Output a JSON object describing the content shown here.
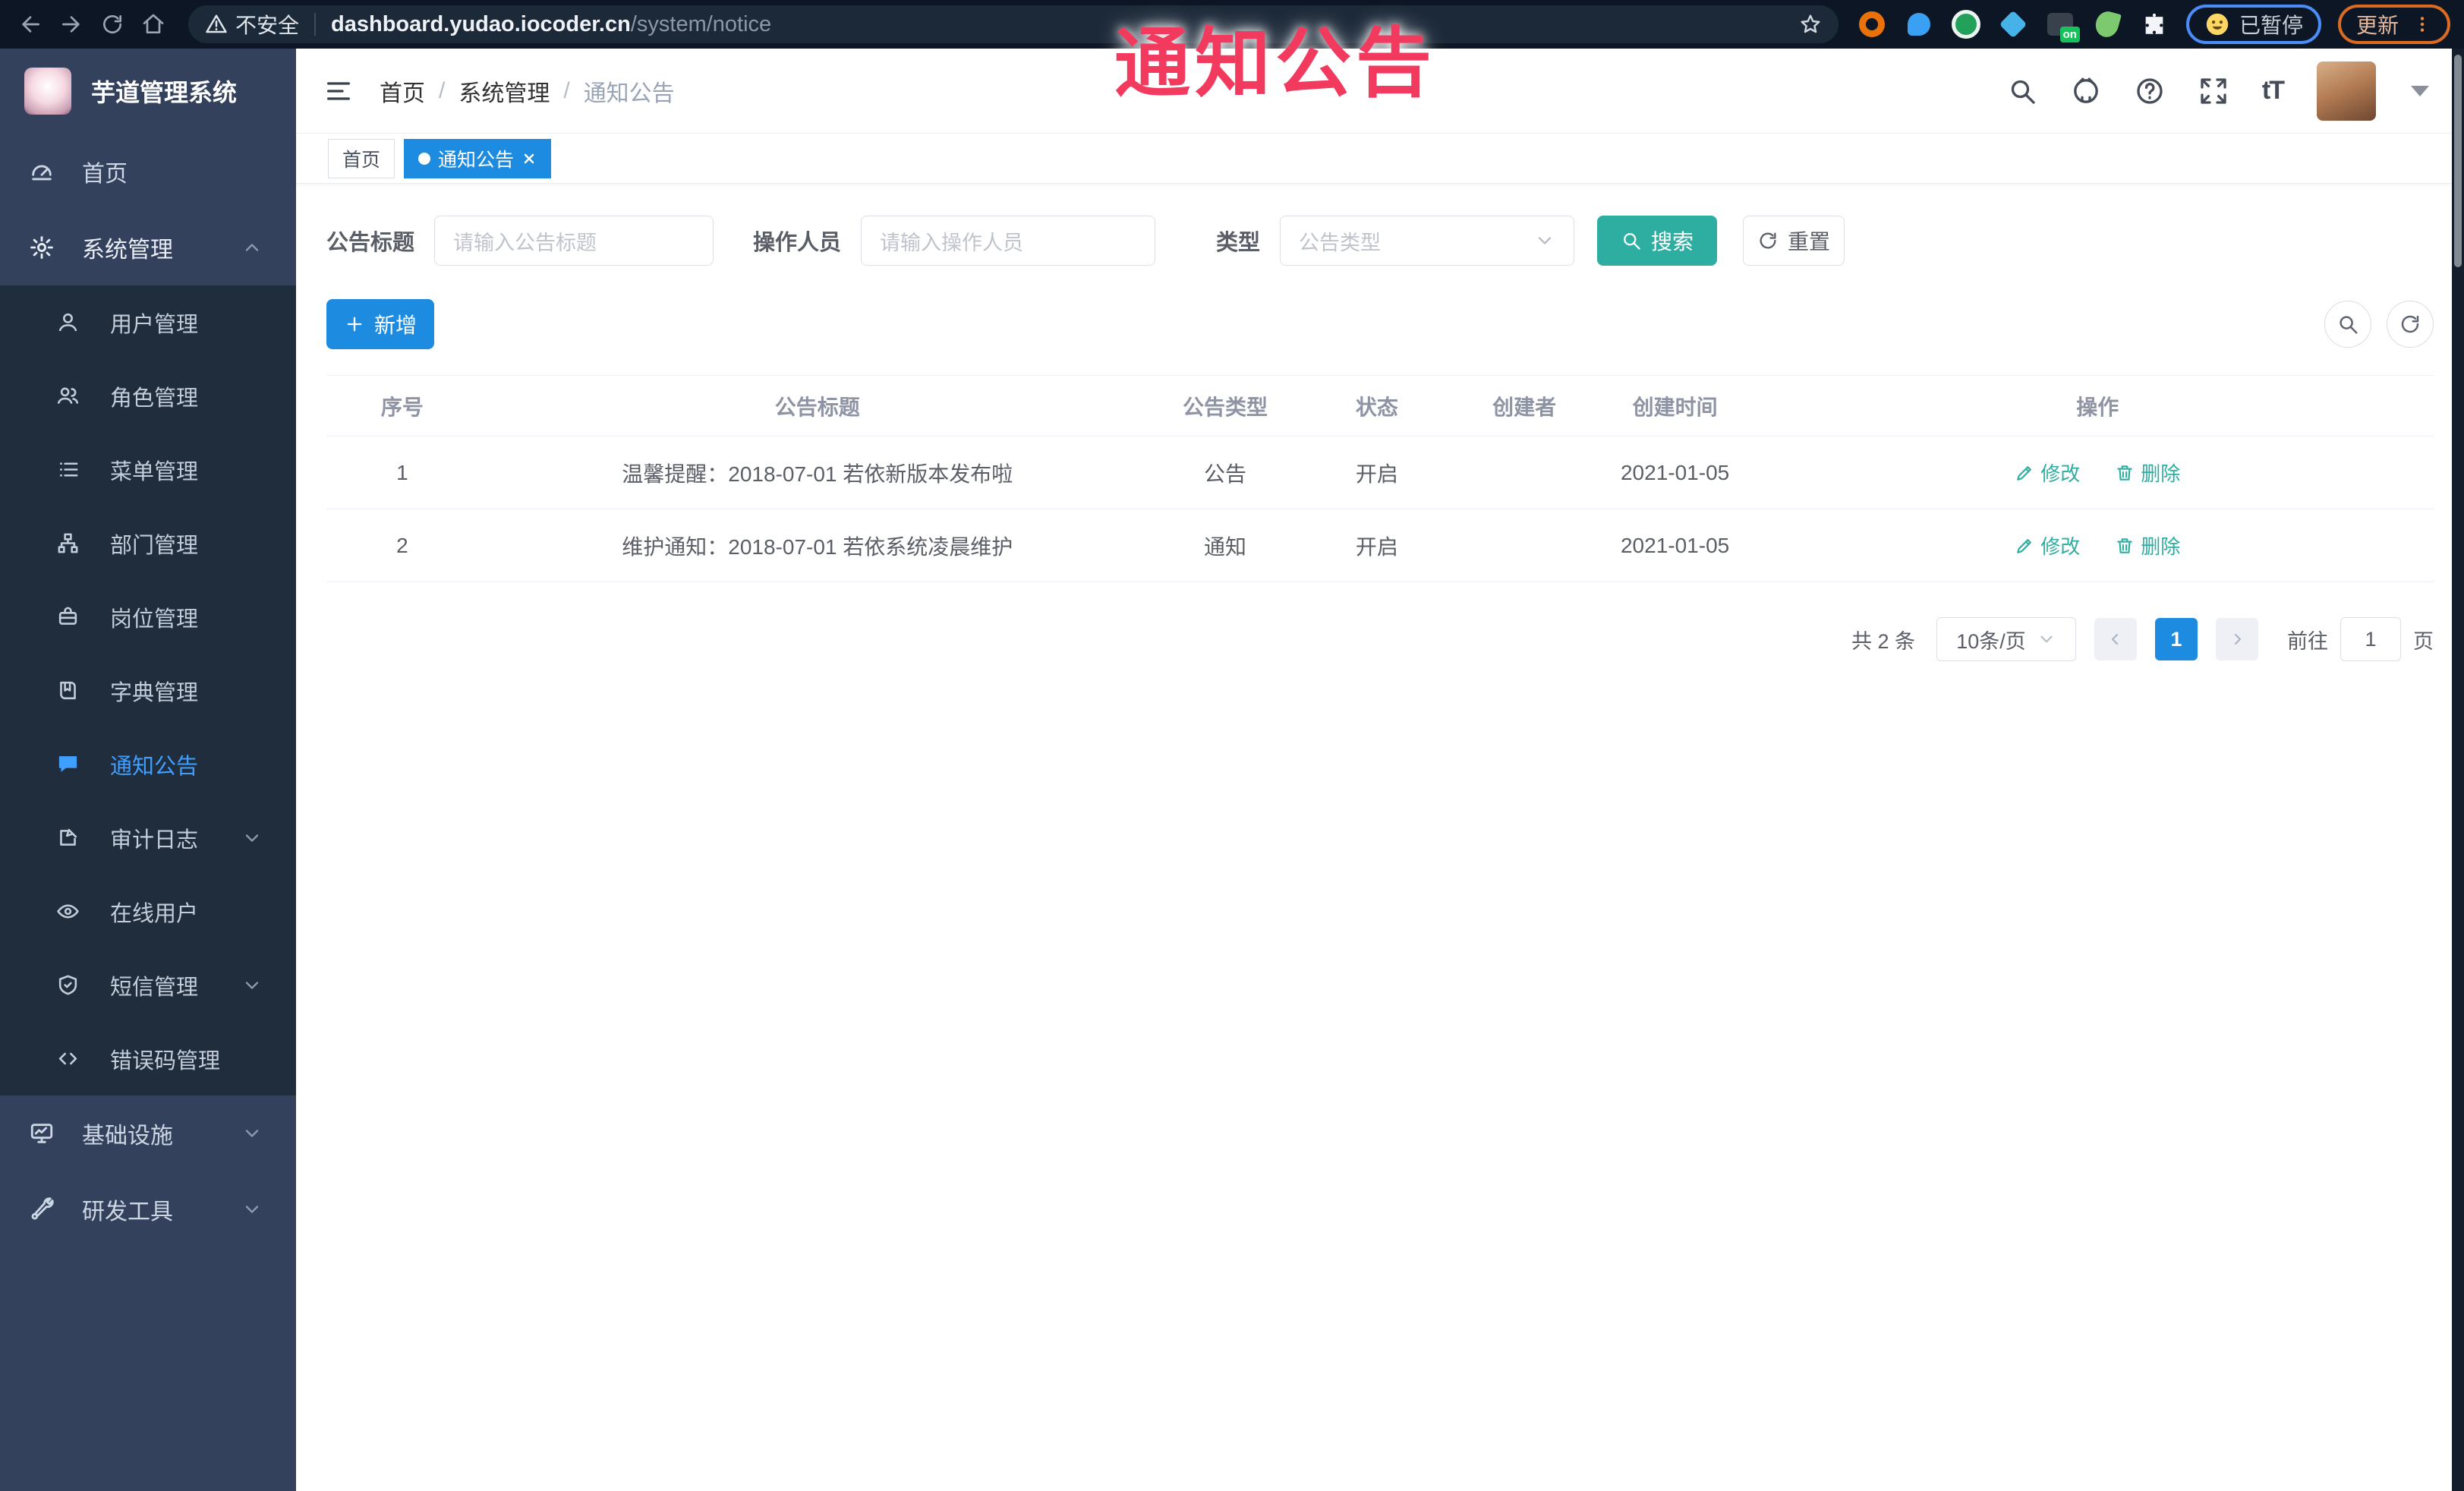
{
  "annotation": {
    "text": "通知公告"
  },
  "colors": {
    "primary": "#1d8ce0",
    "teal": "#2daea0",
    "sidebar": "#33415c",
    "submenu": "#1f2d3d",
    "annotation": "#f23a5f"
  },
  "browser": {
    "security_label": "不安全",
    "url_host": "dashboard.yudao.iocoder.cn",
    "url_path": "/system/notice",
    "paused_badge": "已暂停",
    "update_button": "更新"
  },
  "sidebar": {
    "title": "芋道管理系统",
    "home": "首页",
    "system": "系统管理",
    "children": [
      "用户管理",
      "角色管理",
      "菜单管理",
      "部门管理",
      "岗位管理",
      "字典管理",
      "通知公告",
      "审计日志",
      "在线用户",
      "短信管理",
      "错误码管理"
    ],
    "infra": "基础设施",
    "devtool": "研发工具"
  },
  "header": {
    "breadcrumb": [
      "首页",
      "系统管理",
      "通知公告"
    ]
  },
  "tabs": {
    "home": "首页",
    "active": "通知公告"
  },
  "filters": {
    "title_label": "公告标题",
    "title_ph": "请输入公告标题",
    "operator_label": "操作人员",
    "operator_ph": "请输入操作人员",
    "type_label": "类型",
    "type_ph": "公告类型",
    "search": "搜索",
    "reset": "重置"
  },
  "toolbar": {
    "add": "新增"
  },
  "table": {
    "columns": [
      "序号",
      "公告标题",
      "公告类型",
      "状态",
      "创建者",
      "创建时间",
      "操作"
    ],
    "rows": [
      {
        "no": "1",
        "title": "温馨提醒：2018-07-01 若依新版本发布啦",
        "type": "公告",
        "status": "开启",
        "creator": "",
        "created": "2021-01-05"
      },
      {
        "no": "2",
        "title": "维护通知：2018-07-01 若依系统凌晨维护",
        "type": "通知",
        "status": "开启",
        "creator": "",
        "created": "2021-01-05"
      }
    ],
    "actions": {
      "edit": "修改",
      "delete": "删除"
    }
  },
  "pagination": {
    "total": "共 2 条",
    "size": "10条/页",
    "page": "1",
    "goto": "前往",
    "goto_value": "1",
    "unit": "页"
  }
}
